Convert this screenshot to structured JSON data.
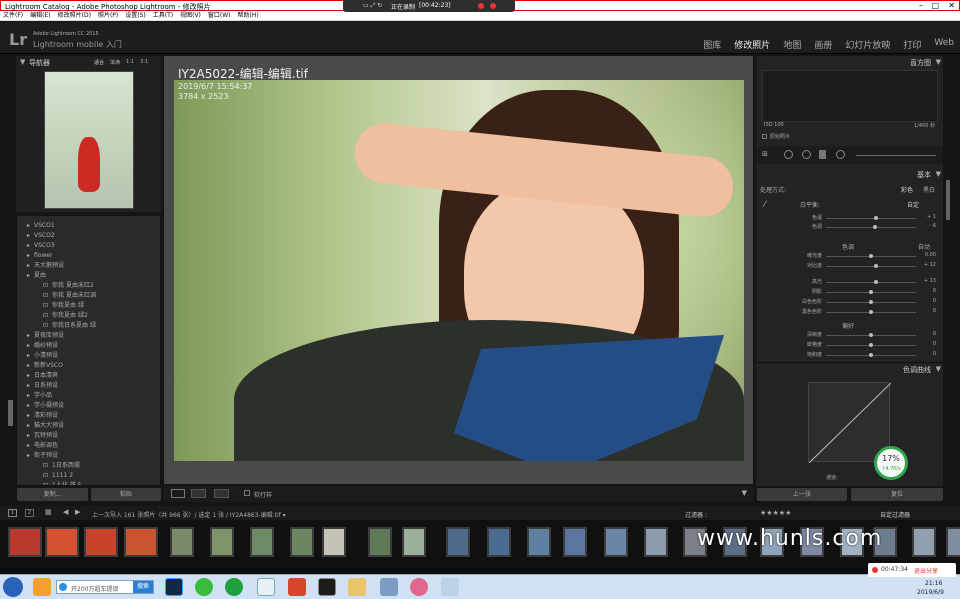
{
  "window": {
    "title": "Lightroom Catalog - Adobe Photoshop Lightroom - 修改照片"
  },
  "menu": [
    "文件(F)",
    "编辑(E)",
    "修改照片(D)",
    "照片(P)",
    "设置(S)",
    "工具(T)",
    "视图(V)",
    "窗口(W)",
    "帮助(H)"
  ],
  "recorder": {
    "label": "正在录制",
    "time": "[00:42:23]"
  },
  "identity": {
    "brand": "Adobe Lightroom CC 2015",
    "app": "Lightroom mobile 入门"
  },
  "modules": [
    "图库",
    "修改照片",
    "地图",
    "画册",
    "幻灯片放映",
    "打印",
    "Web"
  ],
  "navigator": {
    "title": "导航器",
    "zooms": [
      "适合",
      "填满",
      "1:1",
      "3:1"
    ]
  },
  "presets": [
    "VSCO1",
    "VSCO2",
    "VSCO3",
    "flower",
    "天大鹅预设",
    "夏由",
    "你我 夏由末红2",
    "你我 夏由末红调",
    "你我夏由 绿",
    "你我夏由 绿2",
    "你我日系夏由 绿",
    "夏夜库预设",
    "婚纱预设",
    "小清预设",
    "新新VSCO",
    "日本清爽",
    "日系预设",
    "学小品",
    "学小摄预设",
    "清彩预设",
    "猫大大预设",
    "瓦特预设",
    "电影调色",
    "街子预设",
    "1日系西摆",
    "1111 2",
    "1人化 雄 5"
  ],
  "left_buttons": {
    "copy": "复制...",
    "paste": "粘贴"
  },
  "photo": {
    "filename": "IY2A5022-编辑-编辑.tif",
    "datetime": "2019/6/7 15:54:37",
    "dimensions": "3784 x 2523"
  },
  "toolbar": {
    "softproof": "软打样"
  },
  "histogram": {
    "title": "直方图",
    "iso": "ISO 100",
    "shutter": "1/400 秒",
    "original": "原始照片"
  },
  "basic": {
    "title": "基本",
    "treatment": "处理方式:",
    "color": "彩色",
    "bw": "黑白",
    "wb": "白平衡:",
    "wb_value": "自定",
    "tone": "色调",
    "auto": "自动",
    "presence": "偏好"
  },
  "sliders": [
    {
      "label": "色温",
      "value": "+ 1",
      "pos": 0.55
    },
    {
      "label": "色调",
      "value": "- 6",
      "pos": 0.54
    },
    {
      "label": "曝光度",
      "value": "0.00",
      "pos": 0.5
    },
    {
      "label": "对比度",
      "value": "+ 12",
      "pos": 0.56
    },
    {
      "label": "高光",
      "value": "+ 13",
      "pos": 0.56
    },
    {
      "label": "阴影",
      "value": "0",
      "pos": 0.5
    },
    {
      "label": "白色色阶",
      "value": "0",
      "pos": 0.5
    },
    {
      "label": "黑色色阶",
      "value": "0",
      "pos": 0.5
    },
    {
      "label": "清晰度",
      "value": "0",
      "pos": 0.5
    },
    {
      "label": "鲜艳度",
      "value": "0",
      "pos": 0.5
    },
    {
      "label": "饱和度",
      "value": "0",
      "pos": 0.5
    }
  ],
  "tone_curve": {
    "title": "色调曲线",
    "channel": "通道:"
  },
  "right_buttons": {
    "prev": "上一张",
    "reset": "复位"
  },
  "badge": {
    "percent": "17%",
    "speed": "↑4.7K/s"
  },
  "filmstrip": {
    "info": "上一次导入  161 张照片（共 966 张）/ 选定 1 张 / IY2A4863-编辑.tif ▾",
    "filter": "过滤器 :",
    "custom": "自定过滤器"
  },
  "watermark": "www.hunls.com",
  "taskbar": {
    "search_placeholder": "开200万超车提现",
    "search_btn": "搜索",
    "clock": "21:16",
    "date": "2019/6/9"
  },
  "share": {
    "time": "00:47:34",
    "label": "退出分享"
  }
}
